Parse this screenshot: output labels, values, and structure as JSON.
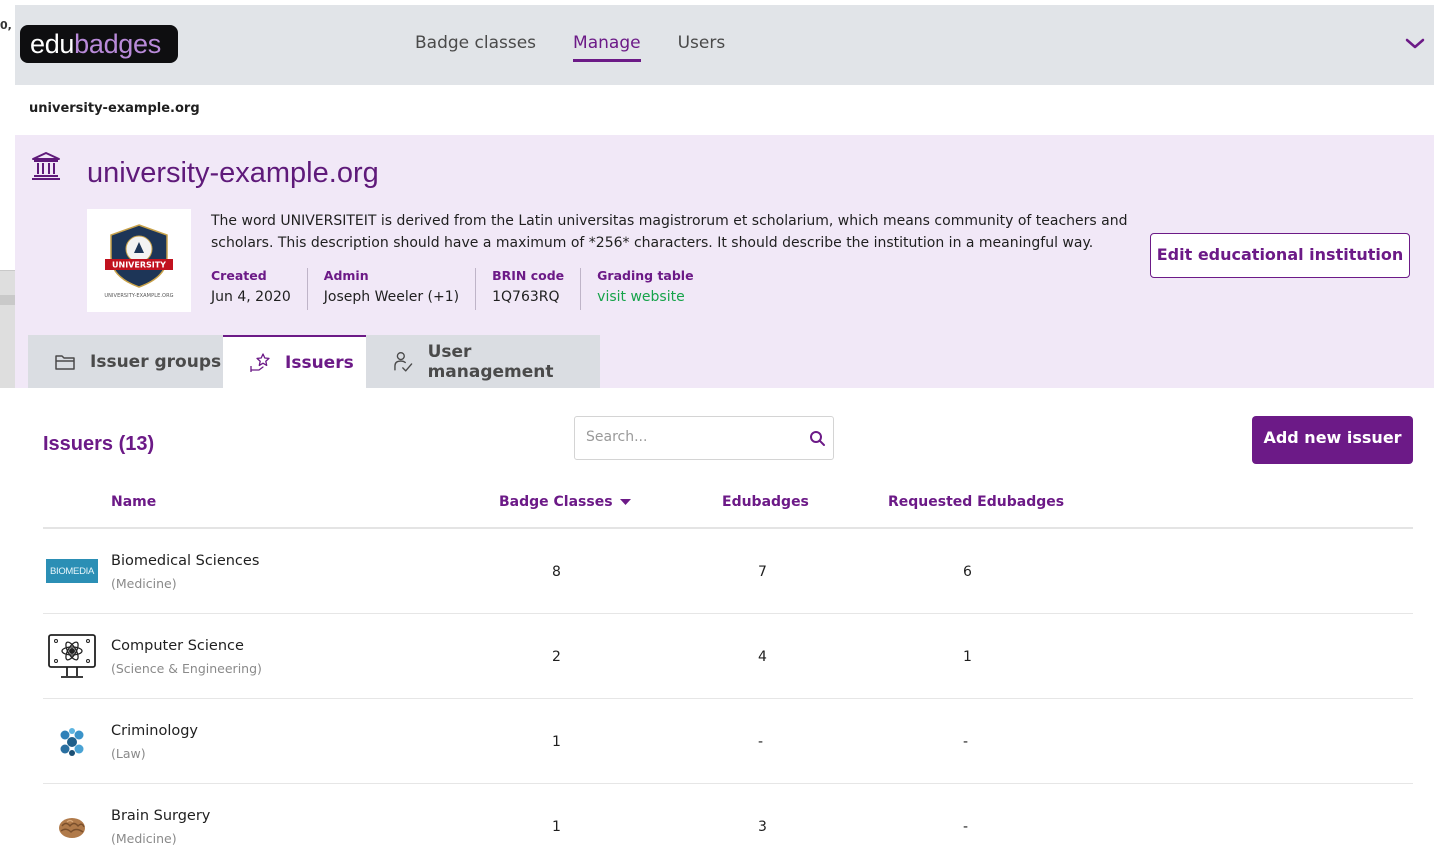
{
  "corner_label": "0,",
  "header": {
    "logo": {
      "part1": "edu",
      "part2": "badges"
    },
    "nav": [
      {
        "label": "Badge classes",
        "active": false
      },
      {
        "label": "Manage",
        "active": true
      },
      {
        "label": "Users",
        "active": false
      }
    ]
  },
  "breadcrumb": "university-example.org",
  "institution": {
    "name": "university-example.org",
    "description": "The word UNIVERSITEIT is derived from the Latin universitas magistrorum et scholarium, which means community of teachers and scholars. This description should have a maximum of *256* characters. It should describe the institution in a meaningful way.",
    "logo_caption": "UNIVERSITY-EXAMPLE.ORG",
    "meta": {
      "created_label": "Created",
      "created_value": "Jun 4, 2020",
      "admin_label": "Admin",
      "admin_value": "Joseph Weeler (+1)",
      "brin_label": "BRIN code",
      "brin_value": "1Q763RQ",
      "grading_label": "Grading table",
      "grading_value": "visit website"
    },
    "edit_button": "Edit educational institution"
  },
  "tabs": [
    {
      "label": "Issuer groups",
      "icon": "folder-icon",
      "active": false
    },
    {
      "label": "Issuers",
      "icon": "award-icon",
      "active": true
    },
    {
      "label": "User management",
      "icon": "user-management-icon",
      "active": false
    }
  ],
  "issuers": {
    "title": "Issuers (13)",
    "search_placeholder": "Search...",
    "add_button": "Add new issuer",
    "columns": {
      "name": "Name",
      "badge_classes": "Badge Classes",
      "edubadges": "Edubadges",
      "requested": "Requested Edubadges"
    },
    "rows": [
      {
        "name": "Biomedical Sciences",
        "faculty": "(Medicine)",
        "badge_classes": "8",
        "edubadges": "7",
        "requested": "6",
        "thumb": "biomedia-logo",
        "thumb_text": "BIOMEDIA"
      },
      {
        "name": "Computer Science",
        "faculty": "(Science & Engineering)",
        "badge_classes": "2",
        "edubadges": "4",
        "requested": "1",
        "thumb": "computer-science-icon"
      },
      {
        "name": "Criminology",
        "faculty": "(Law)",
        "badge_classes": "1",
        "edubadges": "-",
        "requested": "-",
        "thumb": "molecule-icon"
      },
      {
        "name": "Brain Surgery",
        "faculty": "(Medicine)",
        "badge_classes": "1",
        "edubadges": "3",
        "requested": "-",
        "thumb": "brain-icon"
      }
    ]
  },
  "colors": {
    "accent": "#6c1a87",
    "header_bg": "#e1e4e8",
    "institution_bg": "#f1e8f7",
    "link_green": "#16a34a"
  }
}
